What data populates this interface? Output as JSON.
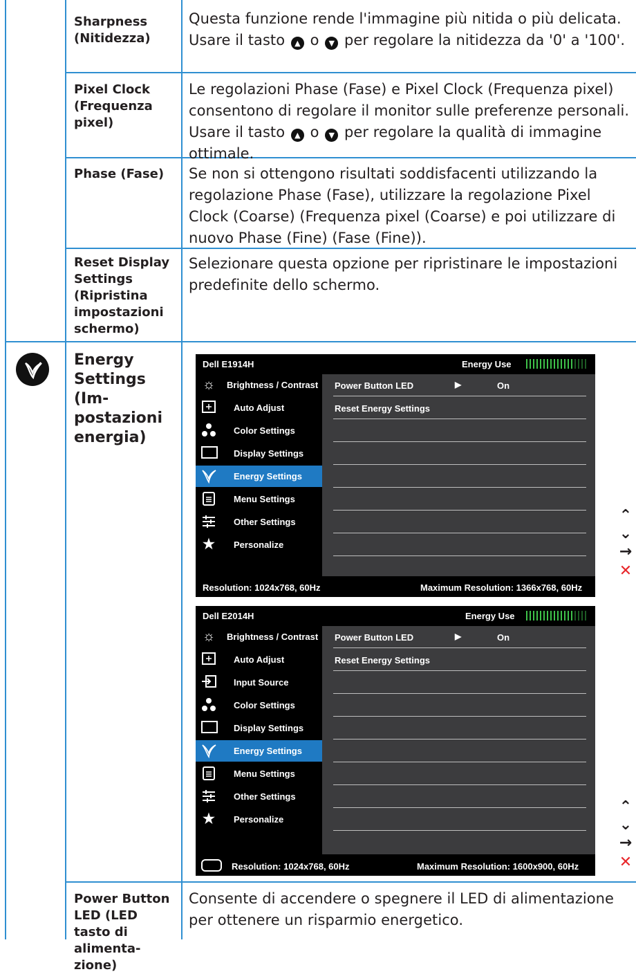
{
  "rows": [
    {
      "label": "Sharpness (Nitidezza)",
      "desc_a": "Questa funzione rende l'immagine più nitida o più delicata. Usare il tasto",
      "desc_mid": "o",
      "desc_b": "per regolare la nitidezza da '0' a '100'."
    },
    {
      "label": "Pixel Clock (Frequenza pixel)",
      "desc_a": "Le regolazioni Phase (Fase) e Pixel Clock (Frequenza pixel) consentono di regolare il monitor sulle preferenze personali. Usare il tasto",
      "desc_mid": "o",
      "desc_b": "per regolare la qualità di immagine ottimale."
    },
    {
      "label": "Phase (Fase)",
      "desc": "Se non si ottengono risultati soddisfacenti utilizzando la regolazione Phase (Fase), utilizzare la regolazione Pixel Clock (Coarse) (Frequenza pixel (Coarse) e poi utilizzare di nuovo Phase (Fine) (Fase (Fine))."
    },
    {
      "label": "Reset Display Settings (Ripristina impostazioni schermo)",
      "desc": "Selezionare questa opzione per ripristinare le impostazioni predefinite dello schermo."
    },
    {
      "label": "Energy Settings (Im-postazioni energia)"
    },
    {
      "label": "Power Button LED (LED tasto di alimenta-zione)",
      "desc": "Consente di accendere o spegnere il LED di alimentazione per ottenere un risparmio energetico."
    }
  ],
  "osd": [
    {
      "model": "Dell E1914H",
      "energy_use": "Energy Use",
      "energy_level": 0.8,
      "menu": [
        "Brightness / Contrast",
        "Auto Adjust",
        "Color Settings",
        "Display Settings",
        "Energy Settings",
        "Menu Settings",
        "Other Settings",
        "Personalize"
      ],
      "icons": [
        "brightness-icon",
        "auto-adjust-icon",
        "color-settings-icon",
        "display-settings-icon",
        "energy-settings-icon",
        "menu-settings-icon",
        "other-settings-icon",
        "star-icon"
      ],
      "active": "Energy Settings",
      "right_items": [
        {
          "label": "Power Button LED",
          "value": "On"
        },
        {
          "label": "Reset Energy Settings"
        }
      ],
      "resolution": "Resolution: 1024x768, 60Hz",
      "max_resolution": "Maximum Resolution: 1366x768, 60Hz"
    },
    {
      "model": "Dell E2014H",
      "energy_use": "Energy Use",
      "energy_level": 0.8,
      "menu": [
        "Brightness / Contrast",
        "Auto Adjust",
        "Input Source",
        "Color Settings",
        "Display Settings",
        "Energy Settings",
        "Menu Settings",
        "Other Settings",
        "Personalize"
      ],
      "icons": [
        "brightness-icon",
        "auto-adjust-icon",
        "input-source-icon",
        "color-settings-icon",
        "display-settings-icon",
        "energy-settings-icon",
        "menu-settings-icon",
        "other-settings-icon",
        "star-icon"
      ],
      "active": "Energy Settings",
      "right_items": [
        {
          "label": "Power Button LED",
          "value": "On"
        },
        {
          "label": "Reset Energy Settings"
        }
      ],
      "resolution": "Resolution: 1024x768, 60Hz",
      "max_resolution": "Maximum Resolution: 1600x900, 60Hz"
    }
  ],
  "colors": {
    "rule": "#2f8fd1",
    "osd_active": "#1f7ac3",
    "nav_close": "#e8262a"
  }
}
